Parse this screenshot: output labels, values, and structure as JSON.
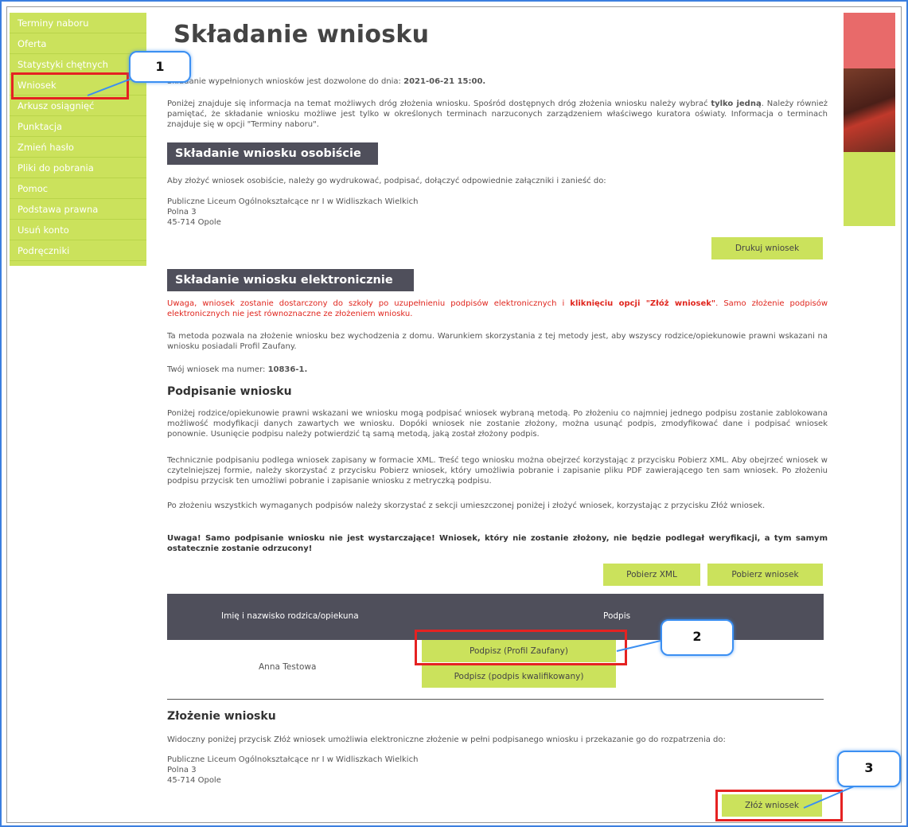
{
  "sidebar": {
    "items": [
      {
        "label": "Terminy naboru"
      },
      {
        "label": "Oferta"
      },
      {
        "label": "Statystyki chętnych"
      },
      {
        "label": "Wniosek"
      },
      {
        "label": "Arkusz osiągnięć"
      },
      {
        "label": "Punktacja"
      },
      {
        "label": "Zmień hasło"
      },
      {
        "label": "Pliki do pobrania"
      },
      {
        "label": "Pomoc"
      },
      {
        "label": "Podstawa prawna"
      },
      {
        "label": "Usuń konto"
      },
      {
        "label": "Podręczniki"
      }
    ]
  },
  "page": {
    "title": "Składanie wniosku",
    "deadline_prefix": "Składanie wypełnionych wniosków jest dozwolone do dnia:",
    "deadline_value": "2021-06-21 15:00.",
    "intro_1": "Poniżej znajduje się informacja na temat możliwych dróg złożenia wniosku. Spośród dostępnych dróg złożenia wniosku należy wybrać",
    "intro_bold": "tylko jedną",
    "intro_2": ". Należy również pamiętać, że składanie wniosku możliwe jest tylko w określonych terminach narzuconych zarządzeniem właściwego kuratora oświaty. Informacja o terminach znajduje się w opcji \"Terminy naboru\"."
  },
  "personal": {
    "heading": "Składanie wniosku osobiście",
    "text": "Aby złożyć wniosek osobiście, należy go wydrukować, podpisać, dołączyć odpowiednie załączniki i zanieść do:",
    "school": "Publiczne Liceum Ogólnokształcące nr I w Widliszkach Wielkich",
    "street": "Polna 3",
    "city": "45-714 Opole",
    "print_button": "Drukuj wniosek"
  },
  "electronic": {
    "heading": "Składanie wniosku elektronicznie",
    "warning_1": "Uwaga, wniosek zostanie dostarczony do szkoły po uzupełnieniu podpisów elektronicznych i",
    "warning_bold": "kliknięciu opcji \"Złóż wniosek\"",
    "warning_2": ". Samo złożenie podpisów elektronicznych nie jest równoznaczne ze złożeniem wniosku.",
    "method_text": "Ta metoda pozwala na złożenie wniosku bez wychodzenia z domu. Warunkiem skorzystania z tej metody jest, aby wszyscy rodzice/opiekunowie prawni wskazani na wniosku posiadali Profil Zaufany.",
    "number_label": "Twój wniosek ma numer:",
    "number_value": "10836-1."
  },
  "signing": {
    "heading": "Podpisanie wniosku",
    "p1": "Poniżej rodzice/opiekunowie prawni wskazani we wniosku mogą podpisać wniosek wybraną metodą. Po złożeniu co najmniej jednego podpisu zostanie zablokowana możliwość modyfikacji danych zawartych we wniosku. Dopóki wniosek nie zostanie złożony, można usunąć podpis, zmodyfikować dane i podpisać wniosek ponownie. Usunięcie podpisu należy potwierdzić tą samą metodą, jaką został złożony podpis.",
    "p2": "Technicznie podpisaniu podlega wniosek zapisany w formacie XML. Treść tego wniosku można obejrzeć korzystając z przycisku Pobierz XML. Aby obejrzeć wniosek w czytelniejszej formie, należy skorzystać z przycisku Pobierz wniosek, który umożliwia pobranie i zapisanie pliku PDF zawierającego ten sam wniosek. Po złożeniu podpisu przycisk ten umożliwi pobranie i zapisanie wniosku z metryczką podpisu.",
    "p3": "Po złożeniu wszystkich wymaganych podpisów należy skorzystać z sekcji umieszczonej poniżej i złożyć wniosek, korzystając z przycisku Złóż wniosek.",
    "p4": "Uwaga! Samo podpisanie wniosku nie jest wystarczające! Wniosek, który nie zostanie złożony, nie będzie podlegał weryfikacji, a tym samym ostatecznie zostanie odrzucony!",
    "xml_button": "Pobierz XML",
    "download_button": "Pobierz wniosek",
    "col_name": "Imię i nazwisko rodzica/opiekuna",
    "col_sign": "Podpis",
    "signer": "Anna Testowa",
    "sign_pz_button": "Podpisz (Profil Zaufany)",
    "sign_q_button": "Podpisz (podpis kwalifikowany)"
  },
  "submit": {
    "heading": "Złożenie wniosku",
    "text": "Widoczny poniżej przycisk Złóż wniosek umożliwia elektroniczne złożenie w pełni podpisanego wniosku i przekazanie go do rozpatrzenia do:",
    "school": "Publiczne Liceum Ogólnokształcące nr I w Widliszkach Wielkich",
    "street": "Polna 3",
    "city": "45-714 Opole",
    "submit_button": "Złóż wniosek"
  },
  "annotations": {
    "one": "1",
    "two": "2",
    "three": "3"
  }
}
